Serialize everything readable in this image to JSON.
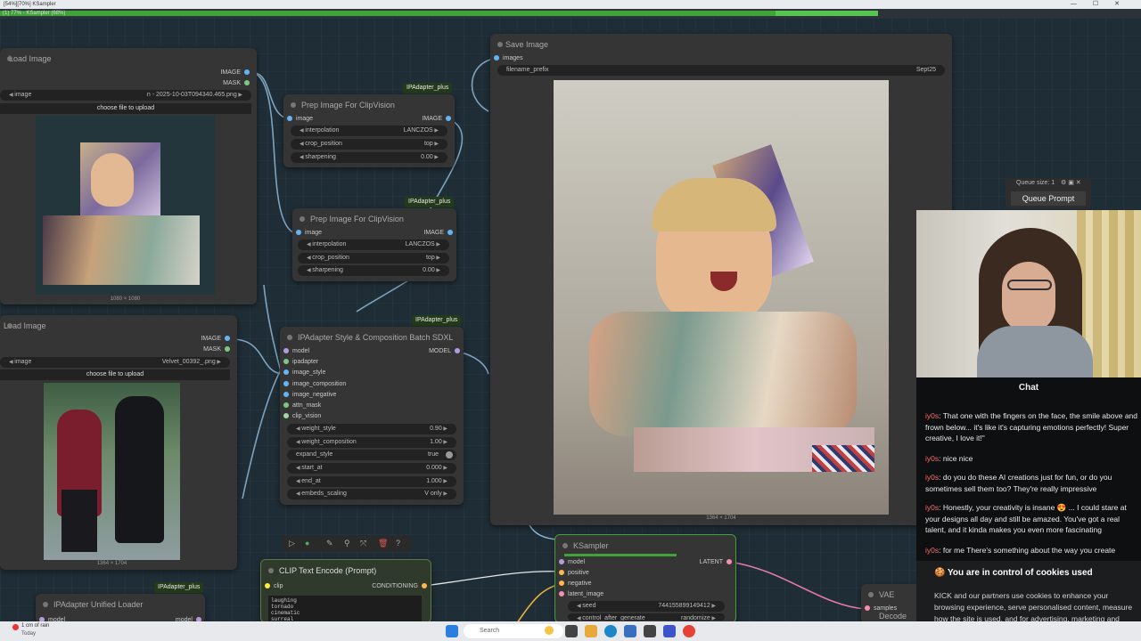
{
  "window": {
    "title": "[54%][70%] KSampler",
    "controls": [
      "—",
      "☐",
      "✕"
    ]
  },
  "progress": {
    "label": "(1) 77% - KSampler (68%)",
    "fraction": 0.77
  },
  "nodes": {
    "load_image_1": {
      "title": "Load Image",
      "out_image": "IMAGE",
      "out_mask": "MASK",
      "image_label": "image",
      "image_value": "n - 2025-10-03T094340.465.png",
      "upload": "choose file to upload",
      "size": "1080 × 1080"
    },
    "load_image_2": {
      "title": "Load Image",
      "out_image": "IMAGE",
      "out_mask": "MASK",
      "image_label": "image",
      "image_value": "Velvet_00392_.png",
      "upload": "choose file to upload",
      "size": "1364 × 1704"
    },
    "prep_1": {
      "badge": "IPAdapter_plus",
      "title": "Prep Image For ClipVision",
      "in_image": "image",
      "out_image": "IMAGE",
      "widgets": [
        {
          "label": "interpolation",
          "value": "LANCZOS"
        },
        {
          "label": "crop_position",
          "value": "top"
        },
        {
          "label": "sharpening",
          "value": "0.00"
        }
      ]
    },
    "prep_2": {
      "badge": "IPAdapter_plus",
      "title": "Prep Image For ClipVision",
      "in_image": "image",
      "out_image": "IMAGE",
      "widgets": [
        {
          "label": "interpolation",
          "value": "LANCZOS"
        },
        {
          "label": "crop_position",
          "value": "top"
        },
        {
          "label": "sharpening",
          "value": "0.00"
        }
      ]
    },
    "ipadapter_style": {
      "badge": "IPAdapter_plus",
      "title": "IPAdapter Style & Composition Batch SDXL",
      "out_model": "MODEL",
      "inputs": [
        "model",
        "ipadapter",
        "image_style",
        "image_composition",
        "image_negative",
        "attn_mask",
        "clip_vision"
      ],
      "widgets": [
        {
          "label": "weight_style",
          "value": "0.90"
        },
        {
          "label": "weight_composition",
          "value": "1.00"
        },
        {
          "label": "expand_style",
          "value": "true"
        },
        {
          "label": "start_at",
          "value": "0.000"
        },
        {
          "label": "end_at",
          "value": "1.000"
        },
        {
          "label": "embeds_scaling",
          "value": "V only"
        }
      ]
    },
    "save_image": {
      "title": "Save Image",
      "in_images": "images",
      "prefix_label": "filename_prefix",
      "prefix_value": "Sept25",
      "size": "1364 × 1704"
    },
    "ksampler": {
      "title": "KSampler",
      "inputs": [
        "model",
        "positive",
        "negative",
        "latent_image"
      ],
      "out_latent": "LATENT",
      "seed_label": "seed",
      "seed_value": "744155899149412",
      "control_label": "control_after_generate",
      "control_value": "randomize"
    },
    "clip_text": {
      "title": "CLIP Text Encode (Prompt)",
      "in_clip": "clip",
      "out_cond": "CONDITIONING",
      "text": "laughing\ntornado\ncinematic\nsurreal"
    },
    "unified_loader": {
      "badge": "IPAdapter_plus",
      "title": "IPAdapter Unified Loader",
      "in_model": "model",
      "out_model": "model"
    },
    "vae_decode": {
      "title": "VAE Decode",
      "in_samples": "samples"
    }
  },
  "queue": {
    "size_label": "Queue size: 1",
    "button": "Queue Prompt"
  },
  "chat": {
    "header": "Chat",
    "messages": [
      {
        "user": "iy0s",
        "text": ": That one with the fingers on the face, the smile above and frown below... it's like it's capturing emotions perfectly! Super creative, I love it!\""
      },
      {
        "user": "iy0s",
        "text": ": nice nice"
      },
      {
        "user": "iy0s",
        "text": ": do you do these AI creations just for fun, or do you sometimes sell them too? They're really impressive"
      },
      {
        "user": "iy0s",
        "text": ": Honestly, your creativity is insane 😍 ... I could stare at your designs all day and still be amazed. You've got a real talent, and it kinda makes you even more fascinating"
      },
      {
        "user": "iy0s",
        "text": ": for me There's something about the way you create"
      }
    ]
  },
  "cookie": {
    "title": "You are in control of cookies used",
    "body": "KICK and our partners use cookies to enhance your browsing experience, serve personalised content, measure how the site is used, and for advertising, marketing and social media purposes."
  },
  "taskbar": {
    "weather": "1 cm of rain",
    "weather_sub": "Today",
    "search": "Search"
  },
  "toolbar_icons": [
    "play-icon",
    "record-icon",
    "pin-icon",
    "bookmark-icon",
    "layout-icon",
    "delete-icon",
    "help-icon"
  ],
  "colors": {
    "progress": "#3fa33a",
    "node_bg": "#353535",
    "ksampler_border": "#3fa33a",
    "link_pink": "#e07aa8",
    "link_blue": "#8fb8d8",
    "link_yellow": "#e3b040",
    "chat_user": "#ff6b6b"
  }
}
